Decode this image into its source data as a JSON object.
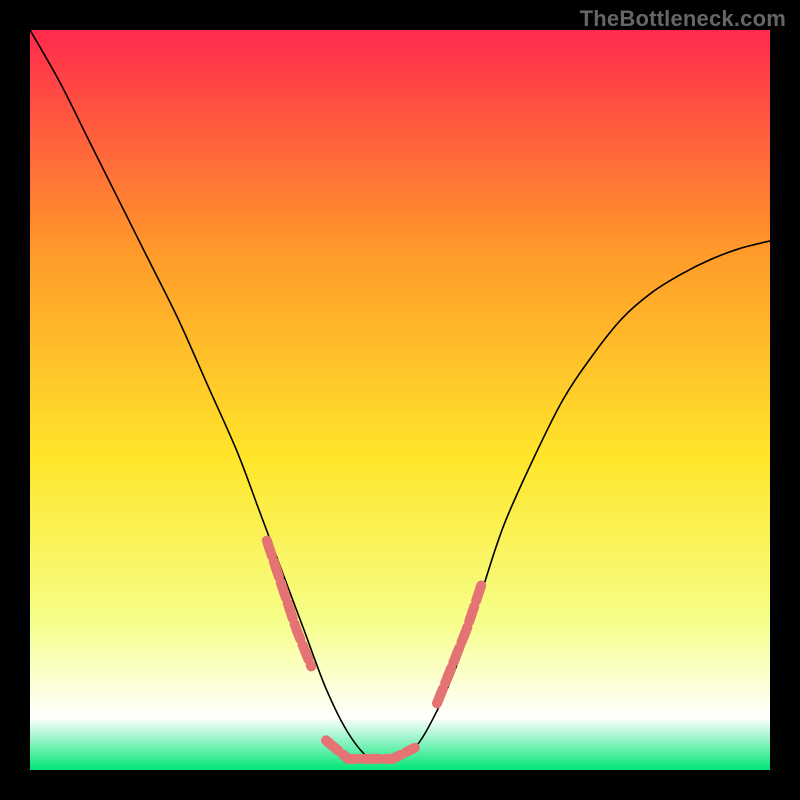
{
  "watermark": "TheBottleneck.com",
  "chart_data": {
    "type": "line",
    "title": "",
    "xlabel": "",
    "ylabel": "",
    "xlim": [
      0,
      100
    ],
    "ylim": [
      0,
      100
    ],
    "grid": false,
    "legend": false,
    "background_gradient": {
      "top": "#ff2a4d",
      "upper_mid": "#ff9a2a",
      "mid": "#ffe62a",
      "lower_mid": "#f6ff8a",
      "bottom_band": "#ffffff",
      "bottom": "#00e676"
    },
    "series": [
      {
        "name": "curve",
        "stroke": "#000000",
        "x": [
          0,
          4,
          8,
          12,
          16,
          20,
          24,
          28,
          31,
          34,
          37,
          40,
          43,
          46,
          49,
          52,
          55,
          58,
          61,
          64,
          68,
          72,
          76,
          80,
          84,
          88,
          92,
          96,
          100
        ],
        "values": [
          100,
          93,
          85,
          77,
          69,
          61,
          52,
          43,
          35,
          27,
          19,
          11,
          5,
          1.5,
          1.5,
          3,
          8,
          15,
          24,
          33,
          42,
          50,
          56,
          61,
          64.5,
          67,
          69,
          70.5,
          71.5
        ]
      },
      {
        "name": "highlight-left",
        "stroke": "#e57373",
        "stroke_width": 10,
        "x": [
          32,
          34,
          36,
          38
        ],
        "values": [
          31,
          25,
          19,
          14
        ]
      },
      {
        "name": "highlight-bottom",
        "stroke": "#e57373",
        "stroke_width": 10,
        "x": [
          40,
          43,
          46,
          49,
          52
        ],
        "values": [
          4,
          1.5,
          1.5,
          1.5,
          3
        ]
      },
      {
        "name": "highlight-right",
        "stroke": "#e57373",
        "stroke_width": 10,
        "x": [
          55,
          57,
          59,
          61
        ],
        "values": [
          9,
          14,
          19,
          25
        ]
      }
    ]
  }
}
